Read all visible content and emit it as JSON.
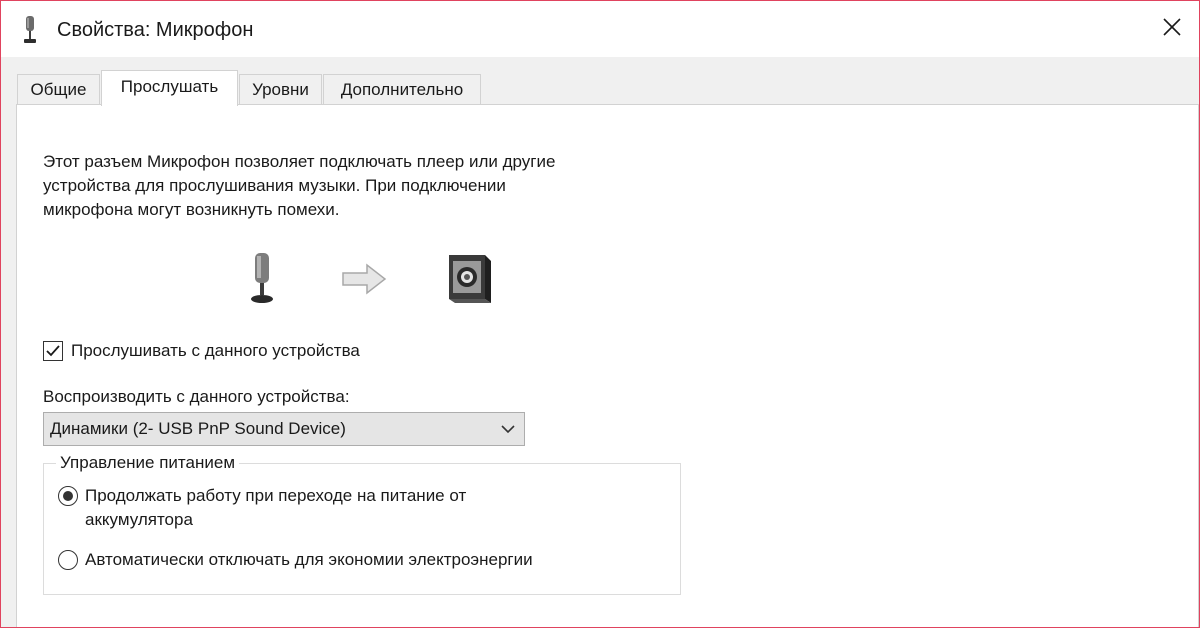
{
  "window": {
    "title": "Свойства: Микрофон",
    "close_icon": "close-icon",
    "title_icon": "microphone-icon"
  },
  "tabs": [
    {
      "label": "Общие",
      "active": false
    },
    {
      "label": "Прослушать",
      "active": true
    },
    {
      "label": "Уровни",
      "active": false
    },
    {
      "label": "Дополнительно",
      "active": false
    }
  ],
  "listen": {
    "description": "Этот разъем Микрофон позволяет подключать плеер или другие\nустройства для прослушивания музыки. При подключении\nмикрофона могут возникнуть помехи.",
    "illustration": {
      "source_icon": "microphone-icon",
      "arrow_icon": "arrow-right-icon",
      "target_icon": "speaker-icon"
    },
    "listen_checkbox": {
      "label": "Прослушивать с данного устройства",
      "checked": true
    },
    "playback_label": "Воспроизводить с данного устройства:",
    "playback_device": {
      "selected": "Динамики (2- USB PnP Sound Device)",
      "chevron_icon": "chevron-down-icon"
    },
    "power": {
      "legend": "Управление питанием",
      "options": [
        {
          "label": "Продолжать работу при переходе на питание от\nаккумулятора",
          "selected": true
        },
        {
          "label": "Автоматически отключать для экономии электроэнергии",
          "selected": false
        }
      ]
    }
  },
  "colors": {
    "window_border": "#e0435e",
    "tab_border": "#d2d2d2",
    "select_bg": "#e5e5e5"
  }
}
